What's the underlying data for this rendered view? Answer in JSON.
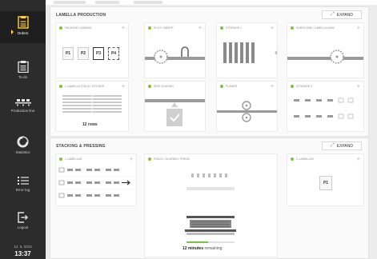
{
  "sidebar": {
    "items": [
      {
        "label": "Orders",
        "icon": "orders-icon"
      },
      {
        "label": "To-do",
        "icon": "todo-icon"
      },
      {
        "label": "Production line",
        "icon": "production-line-icon"
      },
      {
        "label": "Statistics",
        "icon": "statistics-icon"
      },
      {
        "label": "Error log",
        "icon": "error-log-icon"
      },
      {
        "label": "Logout",
        "icon": "logout-icon"
      }
    ],
    "date": "12. 5. 2015",
    "time": "13:37"
  },
  "lamella_production": {
    "title": "LAMELLA PRODUCTION",
    "expand_label": "EXPAND",
    "cards": [
      {
        "title": "PACKAGE LOADING",
        "pallets": [
          "P1",
          "P2",
          "P3",
          "P4"
        ]
      },
      {
        "title": "SCUT / WASTE"
      },
      {
        "title": "STORAGE 1"
      },
      {
        "title": "EUROCONK / LAMELLA SAW"
      },
      {
        "title": "L-LAMELLA STACK / STICKER",
        "rows_label": "12 rows"
      },
      {
        "title": "SIDE GLUEING"
      },
      {
        "title": "PLANER"
      },
      {
        "title": "STORAGE 2"
      }
    ]
  },
  "stacking_pressing": {
    "title": "STACKING & PRESSING",
    "expand_label": "EXPAND",
    "cards": [
      {
        "title": "L-LAMELLAS"
      },
      {
        "title": "STACK / GLUEING / PRESS",
        "time_value": "12 minutes",
        "time_suffix": " remaining",
        "progress": 0.45
      },
      {
        "title": "C-LAMELLAS",
        "pallet": "P1"
      }
    ]
  },
  "colors": {
    "accent": "#ffd23f",
    "status_ok": "#7cc142",
    "sidebar_bg": "#2c2c2c"
  }
}
